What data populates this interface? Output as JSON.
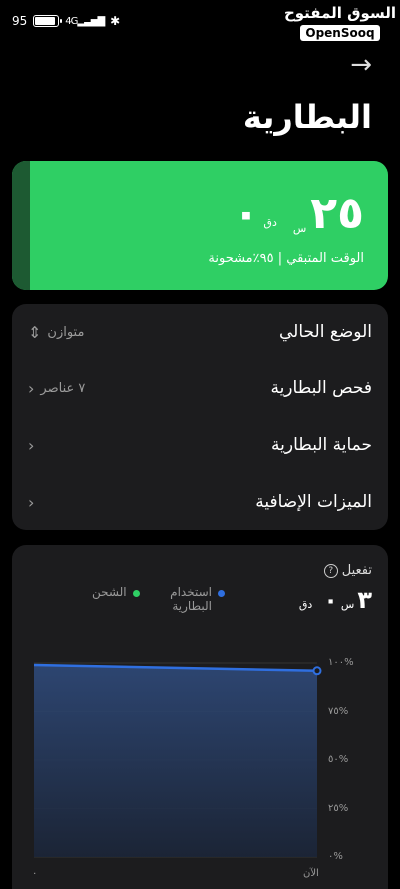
{
  "status_bar": {
    "battery_percent": "95",
    "battery_level": 0.95,
    "signal_text": "4G",
    "bluetooth_icon": "bluetooth-icon"
  },
  "watermark": {
    "arabic": "السوق المفتوح",
    "english": "OpenSooq"
  },
  "header": {
    "back_icon": "arrow-right-icon",
    "title": "البطارية"
  },
  "battery_card": {
    "hours": "٢٥",
    "hours_unit": "س",
    "minutes": "٠",
    "minutes_unit": "دق",
    "remaining_text": "الوقت المتبقي | ٩٥٪مشحونة",
    "color": "#2fcf64"
  },
  "settings": {
    "items": [
      {
        "label": "الوضع الحالي",
        "value": "متوازن",
        "icon": "up-down-icon"
      },
      {
        "label": "فحص البطارية",
        "value": "٧ عناصر",
        "icon": "chevron-left-icon"
      },
      {
        "label": "حماية البطارية",
        "value": "",
        "icon": "chevron-left-icon"
      },
      {
        "label": "الميزات الإضافية",
        "value": "",
        "icon": "chevron-left-icon"
      }
    ]
  },
  "usage": {
    "activate_label": "تفعيل",
    "hours": "٣",
    "hours_unit": "س",
    "minutes": "٠",
    "minutes_unit": "دق",
    "legend_battery": "استخدام البطارية",
    "legend_charging": "الشحن",
    "battery_color": "#2f6fe0",
    "charging_color": "#2fcf64"
  },
  "chart_data": {
    "type": "area",
    "x": [
      "",
      "الآن"
    ],
    "y_ticks": [
      "١٠٠%",
      "٧٥%",
      "٥٠%",
      "٢٥%",
      "٠%"
    ],
    "x_tick_labels": [
      "٠",
      "الآن"
    ],
    "series": [
      {
        "name": "استخدام البطارية",
        "values": [
          99,
          96
        ]
      }
    ],
    "ylim": [
      0,
      100
    ]
  }
}
